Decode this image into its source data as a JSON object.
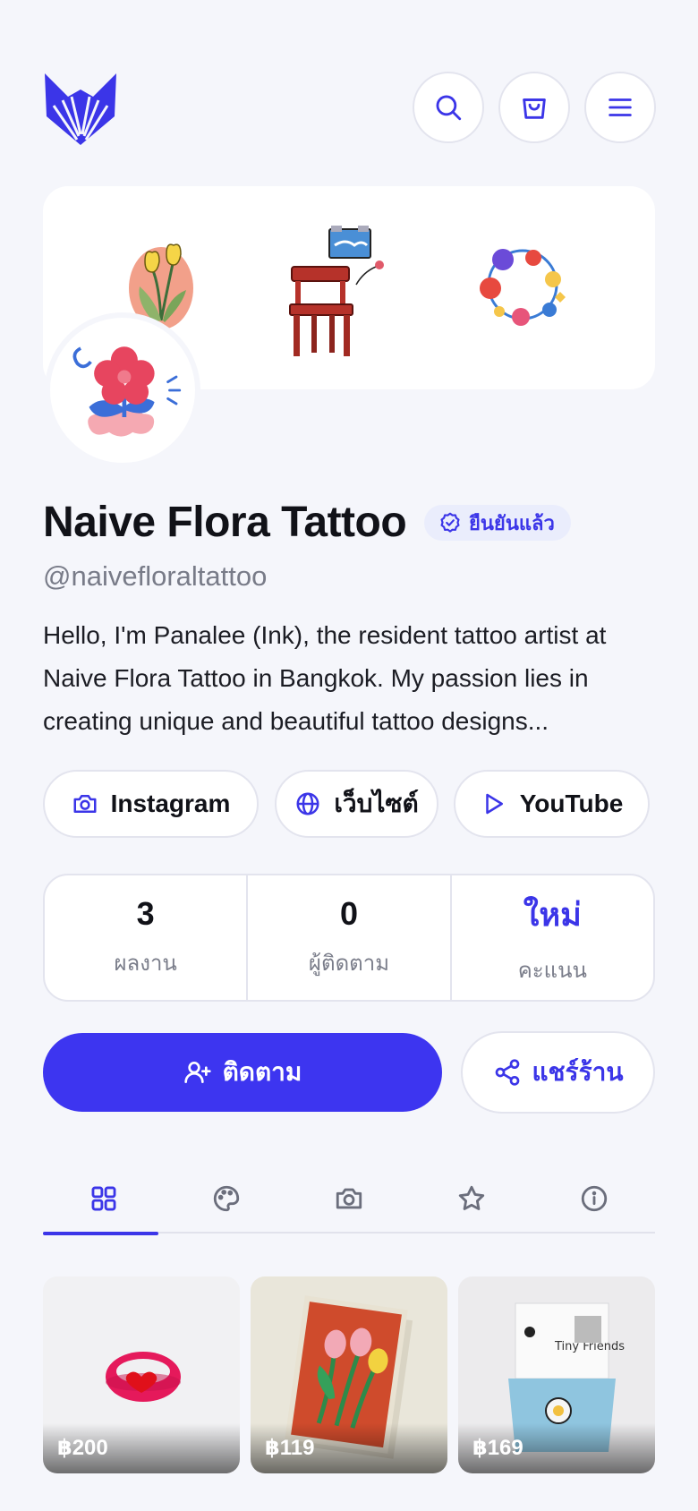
{
  "header": {
    "logo_icon": "fox-logo-icon",
    "search_icon": "search-icon",
    "cart_icon": "shopping-bag-icon",
    "menu_icon": "hamburger-menu-icon"
  },
  "profile": {
    "name": "Naive Flora Tattoo",
    "verified_label": "ยืนยันแล้ว",
    "handle": "@naivefloraltattoo",
    "bio": "Hello, I'm Panalee (Ink), the resident tattoo artist at Naive Flora Tattoo in Bangkok. My passion lies in creating unique and beautiful tattoo designs..."
  },
  "social_links": [
    {
      "label": "Instagram",
      "icon": "camera-icon"
    },
    {
      "label": "เว็บไซต์",
      "icon": "globe-icon"
    },
    {
      "label": "YouTube",
      "icon": "play-icon"
    }
  ],
  "stats": [
    {
      "value": "3",
      "label": "ผลงาน"
    },
    {
      "value": "0",
      "label": "ผู้ติดตาม"
    },
    {
      "value": "ใหม่",
      "label": "คะแนน"
    }
  ],
  "actions": {
    "follow_label": "ติดตาม",
    "share_label": "แชร์ร้าน"
  },
  "tabs": [
    {
      "icon": "grid-icon",
      "active": true
    },
    {
      "icon": "palette-icon",
      "active": false
    },
    {
      "icon": "camera-icon",
      "active": false
    },
    {
      "icon": "star-icon",
      "active": false
    },
    {
      "icon": "info-icon",
      "active": false
    }
  ],
  "products": [
    {
      "price": "฿200"
    },
    {
      "price": "฿119"
    },
    {
      "price": "฿169"
    },
    {
      "product_text": "Tiny Friends"
    }
  ],
  "colors": {
    "accent": "#3b35e8",
    "background": "#f5f6fb"
  }
}
